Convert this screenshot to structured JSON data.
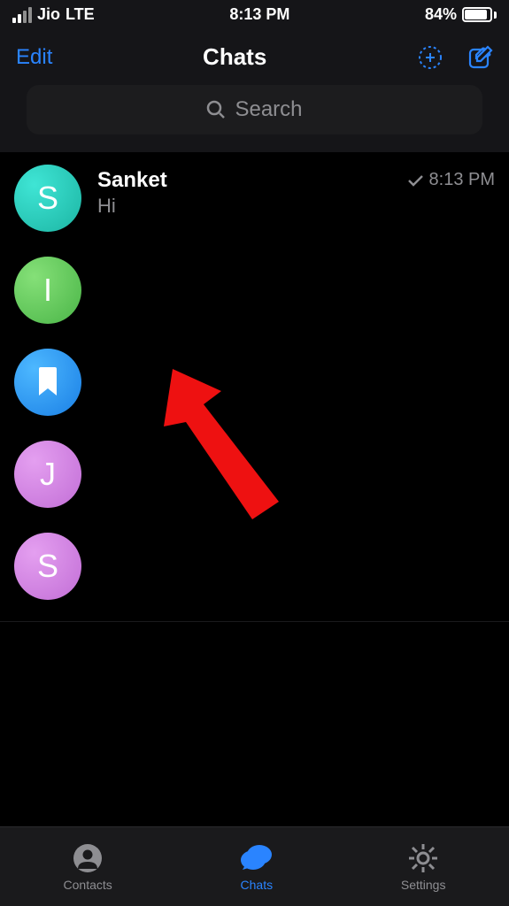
{
  "status": {
    "carrier": "Jio",
    "network": "LTE",
    "time": "8:13 PM",
    "battery_pct": "84%",
    "battery_fill_pct": 84
  },
  "nav": {
    "edit": "Edit",
    "title": "Chats"
  },
  "search": {
    "placeholder": "Search"
  },
  "chats": [
    {
      "name": "Sanket",
      "preview": "Hi",
      "time": "8:13 PM",
      "initial": "S",
      "avatar_class": "av-teal",
      "has_check": true
    },
    {
      "name": "",
      "preview": "",
      "time": "",
      "initial": "I",
      "avatar_class": "av-green",
      "has_check": false
    },
    {
      "name": "",
      "preview": "",
      "time": "",
      "initial": "",
      "avatar_class": "av-blue",
      "has_check": false,
      "is_bookmark": true
    },
    {
      "name": "",
      "preview": "",
      "time": "",
      "initial": "J",
      "avatar_class": "av-pink",
      "has_check": false
    },
    {
      "name": "",
      "preview": "",
      "time": "",
      "initial": "S",
      "avatar_class": "av-pink",
      "has_check": false
    }
  ],
  "tabs": {
    "contacts": "Contacts",
    "chats": "Chats",
    "settings": "Settings"
  }
}
